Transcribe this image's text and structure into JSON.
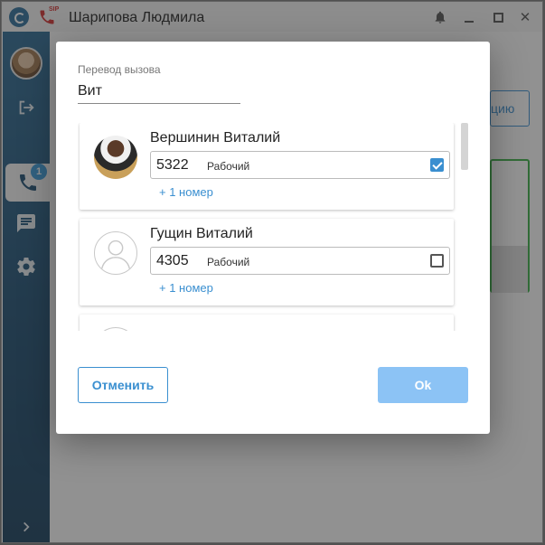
{
  "window": {
    "title": "Шарипова Людмила",
    "sip_tag": "SIP"
  },
  "sidebar": {
    "calls_badge": "1"
  },
  "background": {
    "button_label_partial": "цию"
  },
  "dialog": {
    "field_label": "Перевод вызова",
    "search_value": "Вит",
    "contacts": [
      {
        "name": "Вершинин Виталий",
        "number": "5322",
        "type": "Рабочий",
        "checked": true,
        "more": "+ 1 номер",
        "photo": "user-photo"
      },
      {
        "name": "Гущин Виталий",
        "number": "4305",
        "type": "Рабочий",
        "checked": false,
        "more": "+ 1 номер",
        "photo": "default-avatar-icon"
      }
    ],
    "cancel_label": "Отменить",
    "ok_label": "Ok"
  },
  "colors": {
    "accent": "#3a8fd0",
    "ok_disabled": "#8cc3f5",
    "sidebar": "#2d6a93",
    "success": "#3cb048"
  }
}
